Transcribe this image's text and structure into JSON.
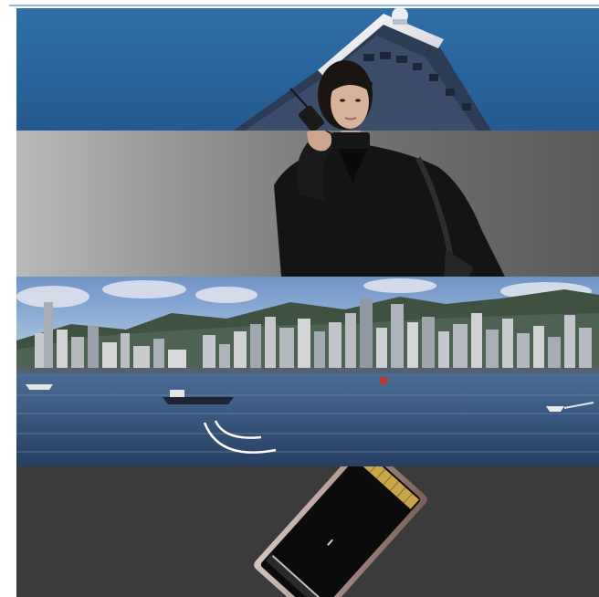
{
  "scene": {
    "panels": [
      "sky-building-panel",
      "gray-gradient-panel",
      "city-harbor-panel",
      "dark-product-panel"
    ],
    "colors": {
      "sky": "#2f6ea8",
      "gray_light": "#b9b9b9",
      "gray_dark": "#5a5a5a",
      "harbor_water": "#2d4f78",
      "product_background": "#3b3b3b"
    }
  }
}
